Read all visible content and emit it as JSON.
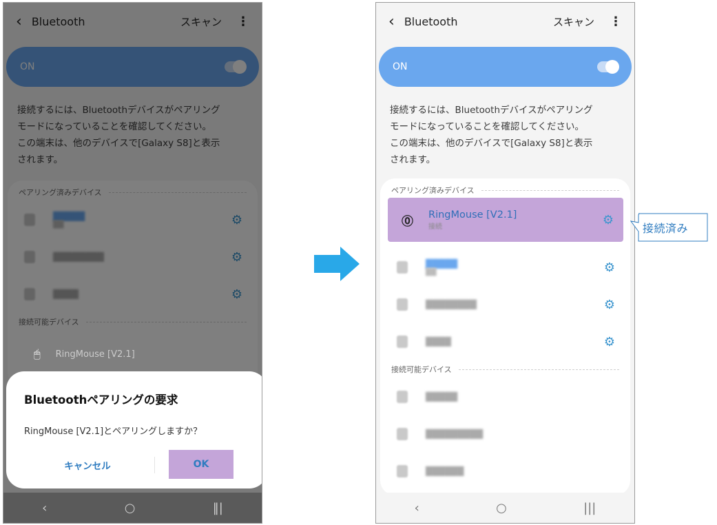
{
  "left_screen": {
    "topbar": {
      "title": "Bluetooth",
      "scan_label": "スキャン"
    },
    "toggle_label": "ON",
    "info_lines": [
      "接続するには、Bluetoothデバイスがペアリング",
      "モードになっていることを確認してください。",
      "この端末は、他のデバイスで[Galaxy S8]と表示",
      "されます。"
    ],
    "paired_header": "ペアリング済みデバイス",
    "available_header": "接続可能デバイス",
    "available_device": "RingMouse [V2.1]",
    "dialog": {
      "title": "Bluetoothペアリングの要求",
      "message": "RingMouse [V2.1]とペアリングしますか？",
      "cancel_label": "キャンセル",
      "ok_label": "OK"
    }
  },
  "right_screen": {
    "topbar": {
      "title": "Bluetooth",
      "scan_label": "スキャン"
    },
    "toggle_label": "ON",
    "info_lines": [
      "接続するには、Bluetoothデバイスがペアリング",
      "モードになっていることを確認してください。",
      "この端末は、他のデバイスで[Galaxy S8]と表示",
      "されます。"
    ],
    "paired_header": "ペアリング済みデバイス",
    "connected_device": {
      "name": "RingMouse [V2.1]",
      "status": "接続"
    },
    "available_header": "接続可能デバイス"
  },
  "callout": {
    "label": "接続済み"
  },
  "icons": {
    "back": "chevron-left-icon",
    "menu": "kebab-menu-icon",
    "settings": "gear-icon",
    "mouse": "mouse-icon",
    "arrow": "right-arrow-icon"
  },
  "colors": {
    "accent_blue": "#6aa7ee",
    "highlight_purple": "#c4a5d9",
    "text_blue": "#2f7cc0",
    "arrow_blue": "#29a8e8"
  }
}
